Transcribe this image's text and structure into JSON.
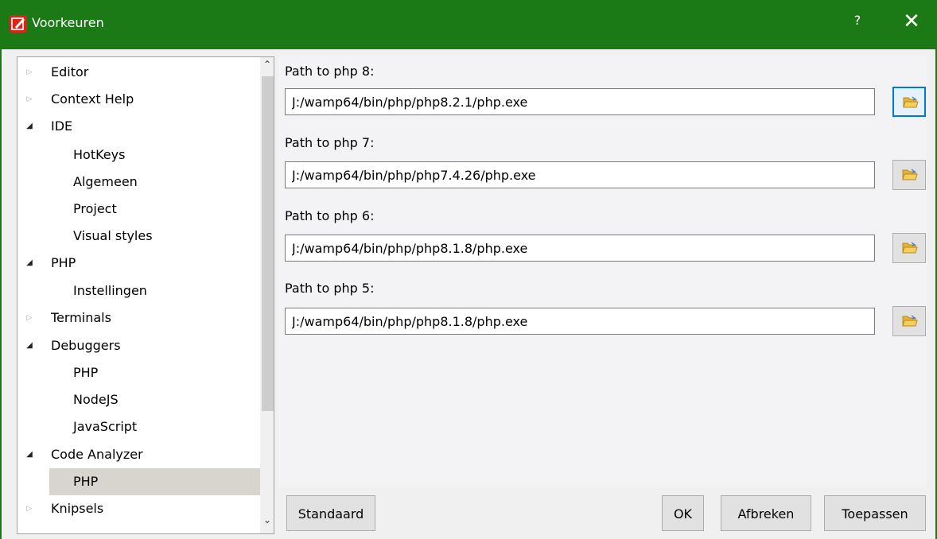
{
  "window": {
    "title": "Voorkeuren",
    "help": "?",
    "close": "✕"
  },
  "tree": {
    "items": [
      {
        "label": "Editor",
        "arrow": "▷"
      },
      {
        "label": "Context Help",
        "arrow": "▷"
      },
      {
        "label": "IDE",
        "arrow": "◢"
      },
      {
        "label": "HotKeys"
      },
      {
        "label": "Algemeen"
      },
      {
        "label": "Project"
      },
      {
        "label": "Visual styles"
      },
      {
        "label": "PHP",
        "arrow": "◢"
      },
      {
        "label": "Instellingen"
      },
      {
        "label": "Terminals",
        "arrow": "▷"
      },
      {
        "label": "Debuggers",
        "arrow": "◢"
      },
      {
        "label": "PHP"
      },
      {
        "label": "NodeJS"
      },
      {
        "label": "JavaScript"
      },
      {
        "label": "Code Analyzer",
        "arrow": "◢"
      },
      {
        "label": "PHP",
        "selected": true
      },
      {
        "label": "Knipsels",
        "arrow": "▷"
      }
    ],
    "scroll_up": "⌃",
    "scroll_down": "⌄"
  },
  "paths": [
    {
      "label": "Path to php 8:",
      "value": "J:/wamp64/bin/php/php8.2.1/php.exe"
    },
    {
      "label": "Path to php 7:",
      "value": "J:/wamp64/bin/php/php7.4.26/php.exe"
    },
    {
      "label": "Path to php 6:",
      "value": "J:/wamp64/bin/php/php8.1.8/php.exe"
    },
    {
      "label": "Path to php 5:",
      "value": "J:/wamp64/bin/php/php8.1.8/php.exe"
    }
  ],
  "buttons": {
    "default": "Standaard",
    "ok": "OK",
    "cancel": "Afbreken",
    "apply": "Toepassen"
  },
  "colors": {
    "titlebar": "#1b7a16",
    "focus": "#0078d7",
    "selected": "#d8d4ce"
  }
}
